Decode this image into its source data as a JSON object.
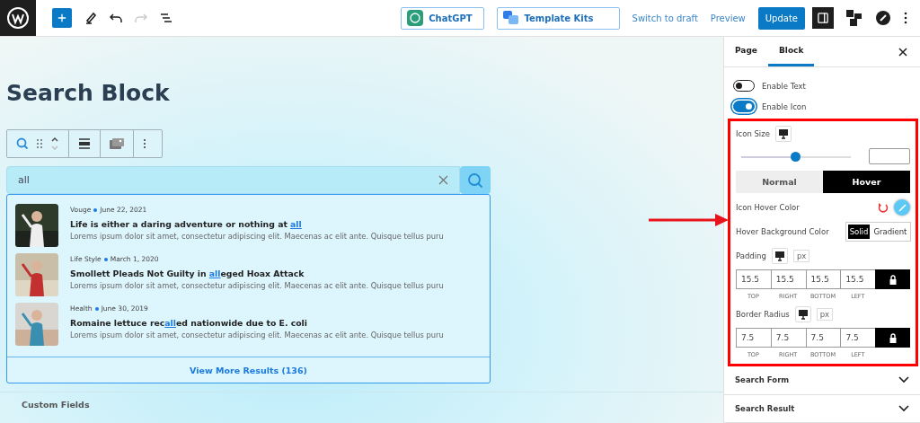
{
  "topbar": {
    "buttons": [
      {
        "label": "ChatGPT",
        "kind": "chatgpt"
      },
      {
        "label": "Template Kits",
        "kind": "kits"
      }
    ],
    "links": [
      "Switch to draft",
      "Preview"
    ],
    "update": "Update"
  },
  "editor": {
    "title": "Search Block",
    "search": {
      "value": "all"
    },
    "results": [
      {
        "category": "Vouge",
        "date": "June 22, 2021",
        "title": {
          "before": "Life is either a daring adventure or nothing at ",
          "match": "all"
        },
        "excerpt": "Lorems ipsum dolor sit amet, consectetur adipiscing elit. Maecenas ac elit ante. Quisque tellus puru"
      },
      {
        "category": "Life Style",
        "date": "March 1, 2020",
        "title": {
          "before": "Smollett Pleads Not Guilty in ",
          "match": "all",
          "after": "eged Hoax Attack"
        },
        "excerpt": "Lorems ipsum dolor sit amet, consectetur adipiscing elit. Maecenas ac elit ante. Quisque tellus puru"
      },
      {
        "category": "Health",
        "date": "June 30, 2019",
        "title": {
          "before": "Romaine lettuce rec",
          "match": "all",
          "after": "ed nationwide due to E. coli"
        },
        "excerpt": "Lorems ipsum dolor sit amet, consectetur adipiscing elit. Maecenas ac elit ante. Quisque tellus puru"
      }
    ],
    "view_more": "View More Results  (136)",
    "custom_fields": "Custom Fields"
  },
  "sidebar": {
    "tabs": [
      {
        "label": "Page",
        "selected": false
      },
      {
        "label": "Block",
        "selected": true
      }
    ],
    "toggles": [
      {
        "label": "Enable Text",
        "on": false
      },
      {
        "label": "Enable Icon",
        "on": true
      }
    ],
    "icon_size": {
      "label": "Icon Size",
      "level": 0.49
    },
    "state_tabs": [
      {
        "label": "Normal",
        "selected": false
      },
      {
        "label": "Hover",
        "selected": true
      }
    ],
    "icon_hover_color": {
      "label": "Icon Hover Color",
      "color": "#5bc8f5"
    },
    "hover_bg": {
      "label": "Hover Background Color",
      "options": [
        {
          "label": "Solid",
          "selected": true
        },
        {
          "label": "Gradient",
          "selected": false
        }
      ]
    },
    "spacings": [
      {
        "label": "Padding",
        "unit": "px",
        "values": [
          "15.5",
          "15.5",
          "15.5",
          "15.5"
        ],
        "sides": [
          "TOP",
          "RIGHT",
          "BOTTOM",
          "LEFT"
        ]
      },
      {
        "label": "Border Radius",
        "unit": "px",
        "values": [
          "7.5",
          "7.5",
          "7.5",
          "7.5"
        ],
        "sides": [
          "TOP",
          "RIGHT",
          "BOTTOM",
          "LEFT"
        ]
      }
    ],
    "sections": [
      {
        "label": "Search Form",
        "expanded": false
      },
      {
        "label": "Search Result",
        "expanded": false
      }
    ]
  }
}
